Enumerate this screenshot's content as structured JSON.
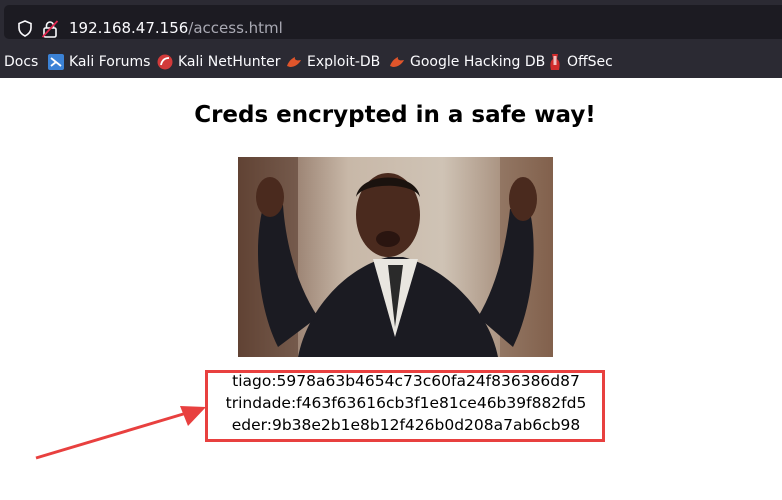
{
  "browser": {
    "url_host": "192.168.47.156",
    "url_path": "/access.html",
    "bookmarks": [
      {
        "label": "Docs",
        "icon": "none"
      },
      {
        "label": "Kali Forums",
        "icon": "kali-forums-icon"
      },
      {
        "label": "Kali NetHunter",
        "icon": "kali-nethunter-icon"
      },
      {
        "label": "Exploit-DB",
        "icon": "exploit-db-icon"
      },
      {
        "label": "Google Hacking DB",
        "icon": "exploit-db-icon"
      },
      {
        "label": "OffSec",
        "icon": "offsec-icon"
      }
    ]
  },
  "page": {
    "heading": "Creds encrypted in a safe way!",
    "credentials": [
      "tiago:5978a63b4654c73c60fa24f836386d87",
      "trindade:f463f63616cb3f1e81ce46b39f882fd5",
      "eder:9b38e2b1e8b12f426b0d208a7ab6cb98"
    ]
  },
  "colors": {
    "chrome_bg": "#2b2a33",
    "url_field_bg": "#1c1b22",
    "annotation_red": "#e8403f"
  }
}
